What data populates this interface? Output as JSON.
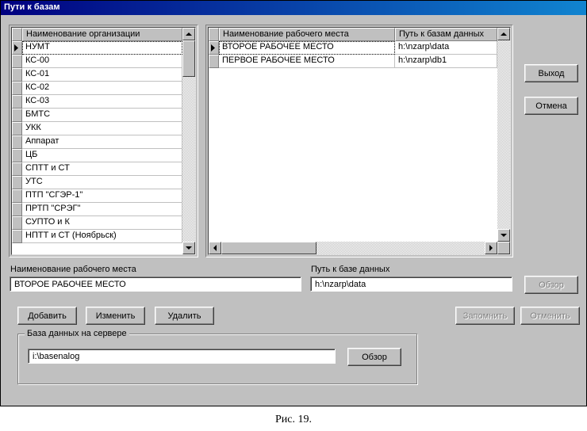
{
  "window": {
    "title": "Пути к базам"
  },
  "org_grid": {
    "header": "Наименование организации",
    "rows": [
      "НУМТ",
      "КС-00",
      "КС-01",
      "КС-02",
      "КС-03",
      "БМТС",
      "УКК",
      "Аппарат",
      "ЦБ",
      "СПТТ и СТ",
      "УТС",
      "ПТП \"СГЭР-1\"",
      "ПРТП \"СРЭГ\"",
      "СУПТО и К",
      "НПТТ и СТ (Ноябрьск)"
    ],
    "selected_index": 0
  },
  "workplace_grid": {
    "headers": [
      "Наименование рабочего места",
      "Путь к базам данных"
    ],
    "rows": [
      {
        "name": "ВТОРОЕ РАБОЧЕЕ МЕСТО",
        "path": "h:\\nzarp\\data"
      },
      {
        "name": "ПЕРВОЕ РАБОЧЕЕ МЕСТО",
        "path": "h:\\nzarp\\db1"
      }
    ],
    "selected_index": 0
  },
  "labels": {
    "workplace_name": "Наименование рабочего места",
    "db_path": "Путь к базе данных"
  },
  "fields": {
    "workplace_name": "ВТОРОЕ РАБОЧЕЕ МЕСТО",
    "db_path": "h:\\nzarp\\data",
    "server_db": "i:\\basenalog"
  },
  "buttons": {
    "exit": "Выход",
    "cancel": "Отмена",
    "browse": "Обзор",
    "add": "Добавить",
    "edit": "Изменить",
    "delete": "Удалить",
    "save": "Запомнить",
    "revert": "Отменить",
    "browse2": "Обзор"
  },
  "groupbox": {
    "server_db": "База данных на сервере"
  },
  "caption": "Рис. 19."
}
